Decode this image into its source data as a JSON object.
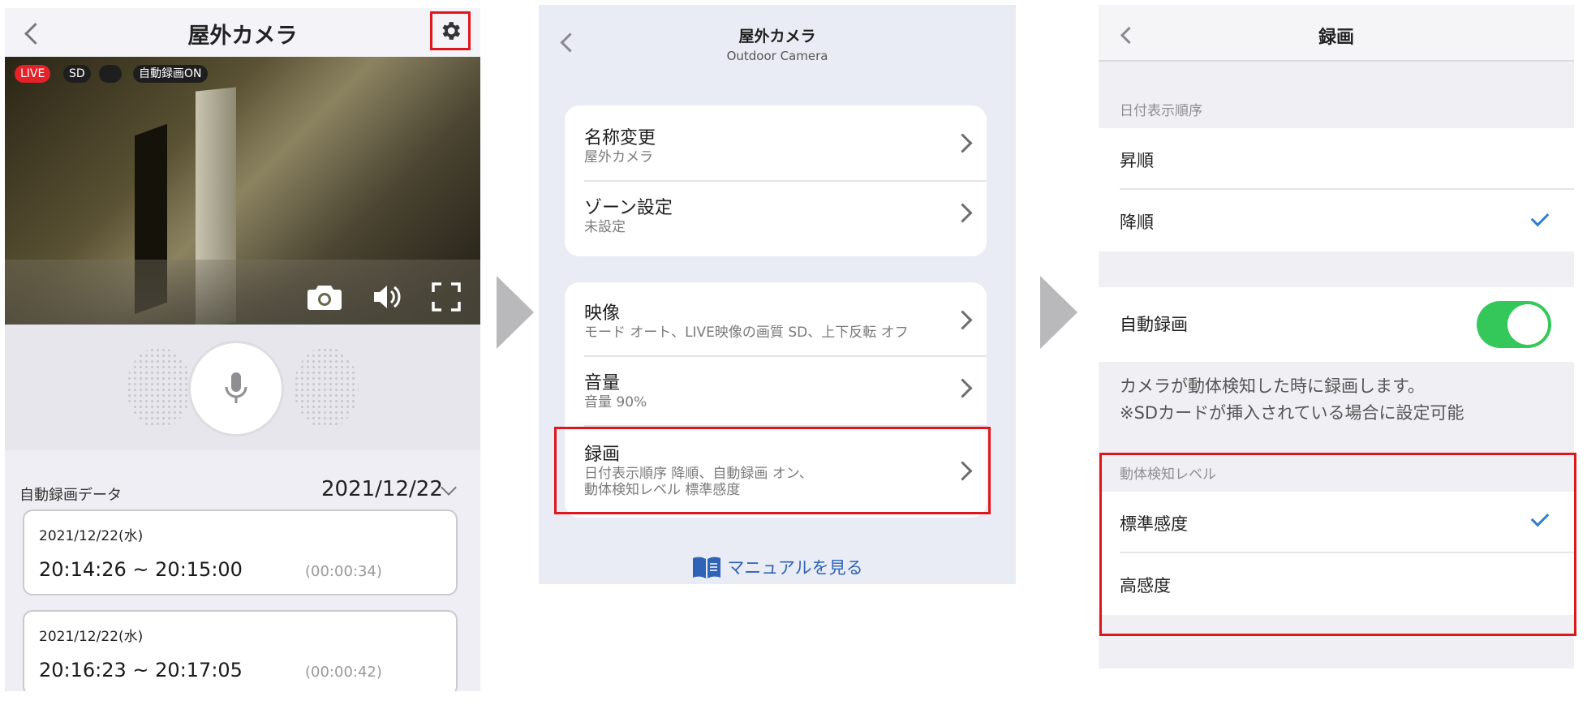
{
  "camera_view": {
    "title": "屋外カメラ",
    "badges": {
      "live": "LIVE",
      "sd": "SD",
      "auto_record": "自動録画ON"
    },
    "records_label": "自動録画データ",
    "selected_date": "2021/12/22",
    "records": [
      {
        "date": "2021/12/22(水)",
        "time_range": "20:14:26 ~ 20:15:00",
        "duration": "(00:00:34)"
      },
      {
        "date": "2021/12/22(水)",
        "time_range": "20:16:23 ~ 20:17:05",
        "duration": "(00:00:42)"
      }
    ]
  },
  "settings_view": {
    "title": "屋外カメラ",
    "subtitle": "Outdoor Camera",
    "group1": [
      {
        "title": "名称変更",
        "sub": "屋外カメラ"
      },
      {
        "title": "ゾーン設定",
        "sub": "未設定"
      }
    ],
    "group2": [
      {
        "title": "映像",
        "sub": "モード オート、LIVE映像の画質 SD、上下反転 オフ"
      },
      {
        "title": "音量",
        "sub": "音量 90%"
      },
      {
        "title": "録画",
        "sub_line1": "日付表示順序 降順、自動録画 オン、",
        "sub_line2": "動体検知レベル 標準感度"
      }
    ],
    "manual_link": "マニュアルを見る"
  },
  "recording_view": {
    "title": "録画",
    "date_order_label": "日付表示順序",
    "date_order_options": [
      "昇順",
      "降順"
    ],
    "date_order_selected": "降順",
    "auto_record_label": "自動録画",
    "auto_record_on": true,
    "description_line1": "カメラが動体検知した時に録画します。",
    "description_line2": "※SDカードが挿入されている場合に設定可能",
    "motion_label": "動体検知レベル",
    "motion_options": [
      "標準感度",
      "高感度"
    ],
    "motion_selected": "標準感度"
  },
  "colors": {
    "highlight": "#e0161d",
    "live_badge": "#e5212a",
    "toggle_on": "#34c759",
    "check": "#2f7fd1",
    "link": "#2e63b8"
  },
  "icons": [
    "back-chevron-icon",
    "gear-icon",
    "camera-icon",
    "speaker-icon",
    "fullscreen-icon",
    "microphone-icon",
    "chevron-down-icon",
    "chevron-right-icon",
    "book-icon",
    "checkmark-icon"
  ]
}
